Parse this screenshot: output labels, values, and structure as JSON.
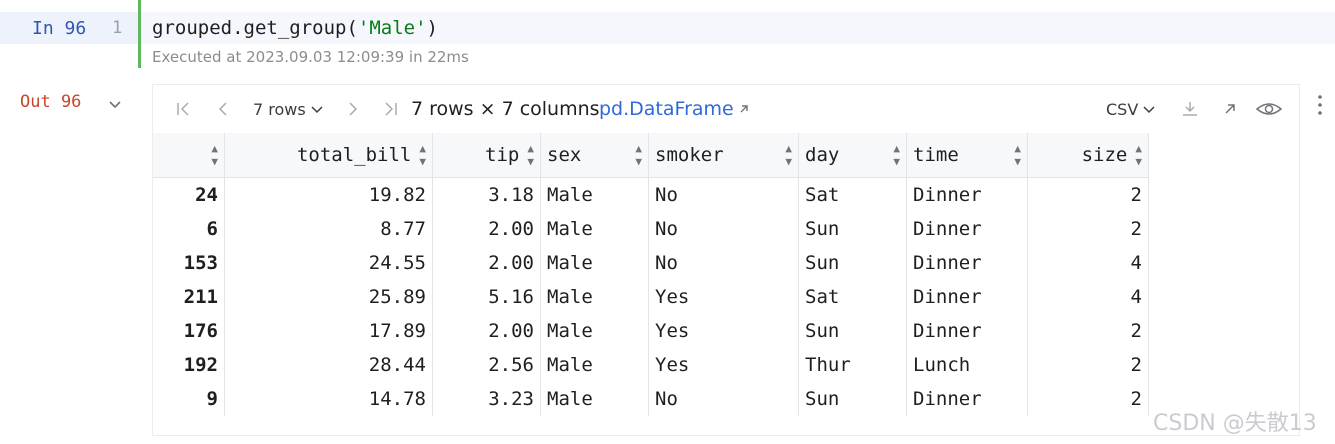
{
  "input_cell": {
    "label": "In 96",
    "line_number": "1",
    "code_prefix": "grouped.get_group(",
    "code_string": "'Male'",
    "code_suffix": ")",
    "executed": "Executed at 2023.09.03 12:09:39 in 22ms"
  },
  "output_cell": {
    "label": "Out 96"
  },
  "toolbar": {
    "rows_per_page": "7 rows",
    "dimensions": "7 rows × 7 columns",
    "type_link": "pd.DataFrame",
    "export_format": "CSV"
  },
  "table": {
    "columns": [
      "",
      "total_bill",
      "tip",
      "sex",
      "smoker",
      "day",
      "time",
      "size"
    ],
    "rows": [
      [
        "24",
        "19.82",
        "3.18",
        "Male",
        "No",
        "Sat",
        "Dinner",
        "2"
      ],
      [
        "6",
        "8.77",
        "2.00",
        "Male",
        "No",
        "Sun",
        "Dinner",
        "2"
      ],
      [
        "153",
        "24.55",
        "2.00",
        "Male",
        "No",
        "Sun",
        "Dinner",
        "4"
      ],
      [
        "211",
        "25.89",
        "5.16",
        "Male",
        "Yes",
        "Sat",
        "Dinner",
        "4"
      ],
      [
        "176",
        "17.89",
        "2.00",
        "Male",
        "Yes",
        "Sun",
        "Dinner",
        "2"
      ],
      [
        "192",
        "28.44",
        "2.56",
        "Male",
        "Yes",
        "Thur",
        "Lunch",
        "2"
      ],
      [
        "9",
        "14.78",
        "3.23",
        "Male",
        "No",
        "Sun",
        "Dinner",
        "2"
      ]
    ]
  },
  "watermark": "CSDN @失散13",
  "icons": {
    "first_page": "first-page-icon",
    "prev_page": "prev-page-icon",
    "next_page": "next-page-icon",
    "last_page": "last-page-icon",
    "download": "download-icon",
    "open_external": "open-external-icon",
    "view": "eye-icon",
    "more": "more-vertical-icon"
  },
  "colors": {
    "cell_bar": "#5fb85f",
    "in_label": "#2e57b5",
    "out_label": "#c6462b",
    "link": "#2e6bd6",
    "string": "#067d17"
  }
}
